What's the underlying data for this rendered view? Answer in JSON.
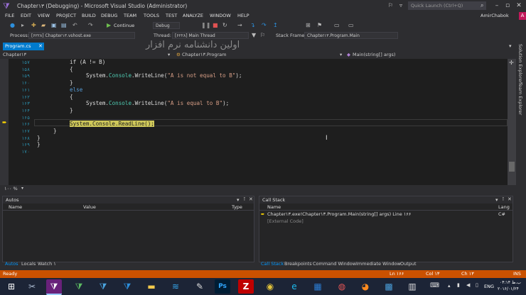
{
  "window": {
    "title": "Chapter۱۳ (Debugging) - Microsoft Visual Studio (Administrator)",
    "quick_launch_placeholder": "Quick Launch (Ctrl+Q)",
    "user": "AmirChabok",
    "avatar_letter": "A"
  },
  "menu": [
    "FILE",
    "EDIT",
    "VIEW",
    "PROJECT",
    "BUILD",
    "DEBUG",
    "TEAM",
    "TOOLS",
    "TEST",
    "ANALYZE",
    "WINDOW",
    "HELP"
  ],
  "toolbar": {
    "continue_label": "Continue",
    "config_value": "Debug",
    "process_label": "Process:",
    "process_value": "[۶۲۲۸] Chapter۱۳.vshost.exe",
    "thread_label": "Thread:",
    "thread_value": "[۶۲۲۸] Main Thread",
    "stack_frame_label": "Stack Frame:",
    "stack_frame_value": "Chapter۱۳.Program.Main"
  },
  "watermark": "اولین دانشنامه نرم افزار",
  "document": {
    "tab_label": "Program.cs",
    "nav_project": "Chapter۱۳",
    "nav_class": "Chapter۱۳.Program",
    "nav_member": "Main(string[] args)"
  },
  "code_lines": [
    {
      "num": "۱۵۷",
      "text": "if (A != B)"
    },
    {
      "num": "۱۵۸",
      "text": "{"
    },
    {
      "num": "۱۵۹",
      "pre": "System.",
      "type": "Console",
      "mid": ".WriteLine(",
      "str": "\"A is not equal to B\"",
      "post": ");"
    },
    {
      "num": "۱۶۰",
      "text": "}"
    },
    {
      "num": "۱۶۱",
      "kw": "else"
    },
    {
      "num": "۱۶۲",
      "text": "{"
    },
    {
      "num": "۱۶۳",
      "pre": "System.",
      "type": "Console",
      "mid": ".WriteLine(",
      "str": "\"A is equal to B\"",
      "post": ");"
    },
    {
      "num": "۱۶۴",
      "text": "}"
    },
    {
      "num": "۱۶۵",
      "text": ""
    },
    {
      "num": "۱۶۶",
      "hl": "System.Console.ReadLine();"
    },
    {
      "num": "۱۶۷",
      "text": "}"
    },
    {
      "num": "۱۶۸",
      "text": "}"
    },
    {
      "num": "۱۶۹",
      "text": "}"
    },
    {
      "num": "۱۷۰",
      "text": ""
    }
  ],
  "zoom": "۱۰۰ %",
  "right_rail": [
    "Solution Explorer",
    "Team Explorer"
  ],
  "autos": {
    "title": "Autos",
    "columns": [
      "Name",
      "Value",
      "Type"
    ],
    "tabs": [
      "Autos",
      "Locals",
      "Watch ۱"
    ]
  },
  "callstack": {
    "title": "Call Stack",
    "columns": [
      "Name",
      "Lang"
    ],
    "rows": [
      {
        "name": "Chapter۱۳.exe!Chapter۱۳.Program.Main(string[] args) Line ۱۶۶",
        "lang": "C#"
      },
      {
        "name": "[External Code]",
        "lang": ""
      }
    ],
    "tabs": [
      "Call Stack",
      "Breakpoints",
      "Command Window",
      "Immediate Window",
      "Output"
    ]
  },
  "status": {
    "ready": "Ready",
    "ln": "Ln ۱۶۶",
    "col": "Col ۱۳",
    "ch": "Ch ۱۳",
    "ins": "INS"
  },
  "taskbar": {
    "lang": "ENG",
    "time": "ب.ظ ۰۴:۱۴",
    "date": "۲۰۱۶/۰۱/۲۴",
    "icons": [
      "windows-start",
      "settings-tools",
      "visual-studio-2012",
      "visual-studio-2013",
      "visual-studio-2010",
      "visual-studio-code",
      "file-explorer",
      "azure",
      "paint",
      "photoshop",
      "filezilla",
      "chrome",
      "internet-explorer",
      "outlook",
      "media",
      "firefox",
      "task-manager",
      "calculator"
    ]
  },
  "colors": {
    "accent": "#007acc",
    "status_debug": "#ca5100",
    "highlight": "#cfc85a"
  }
}
